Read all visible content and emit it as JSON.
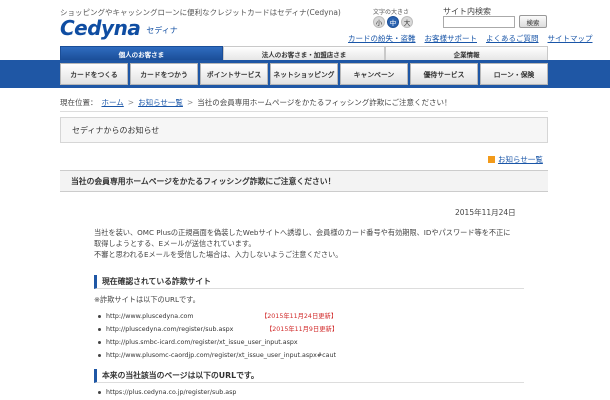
{
  "header": {
    "tagline": "ショッピングやキャッシングローンに便利なクレジットカードはセディナ(Cedyna)",
    "logo_text": "Cedyna",
    "logo_sub": "セディナ",
    "fontsize_label": "文字の大きさ",
    "fontsize_buttons": [
      "小",
      "中",
      "大"
    ],
    "search_label": "サイト内検索",
    "search_placeholder": "",
    "search_button": "検索",
    "util_links": [
      "カードの紛失・盗難",
      "お客様サポート",
      "よくあるご質問",
      "サイトマップ"
    ]
  },
  "tabs": [
    "個人のお客さま",
    "法人のお客さま・加盟店さま",
    "企業情報"
  ],
  "gnav": [
    "カードをつくる",
    "カードをつかう",
    "ポイントサービス",
    "ネットショッピング",
    "キャンペーン",
    "優待サービス",
    "ローン・保険"
  ],
  "breadcrumb": {
    "label": "現在位置：",
    "items": [
      "ホーム",
      "お知らせ一覧",
      "当社の会員専用ホームページをかたるフィッシング詐欺にご注意ください！"
    ]
  },
  "notice_title": "セディナからのお知らせ",
  "list_link": "お知らせ一覧",
  "article": {
    "title": "当社の会員専用ホームページをかたるフィッシング詐欺にご注意ください！",
    "date": "2015年11月24日",
    "body": [
      "当社を装い、OMC Plusの正規画面を偽装したWebサイトへ誘導し、会員様のカード番号や有効期限、IDやパスワード等を不正に",
      "取得しようとする、Eメールが送信されています。",
      "不審と思われるEメールを受信した場合は、入力しないようご注意ください。"
    ],
    "section1": {
      "heading": "現在確認されている詐欺サイト",
      "note": "※詐欺サイトは以下のURLです。",
      "urls": [
        {
          "url": "http://www.pluscedyna.com",
          "updated": "【2015年11月24日更新】"
        },
        {
          "url": "http://pluscedyna.com/register/sub.aspx",
          "updated": "【2015年11月9日更新】"
        },
        {
          "url": "http://plus.smbc-icard.com/register/xt_issue_user_input.aspx",
          "updated": ""
        },
        {
          "url": "http://www.plusomc-caordjp.com/register/xt_issue_user_input.aspx#caut",
          "updated": ""
        }
      ]
    },
    "section2": {
      "heading": "本来の当社該当のページは以下のURLです。",
      "urls": [
        "https://plus.cedyna.co.jp/register/sub.asp"
      ]
    }
  },
  "colors": {
    "brand_blue": "#1f57a5",
    "link_blue": "#1a56a8",
    "alert_red": "#d12a2a",
    "accent_orange": "#f29a1a"
  }
}
